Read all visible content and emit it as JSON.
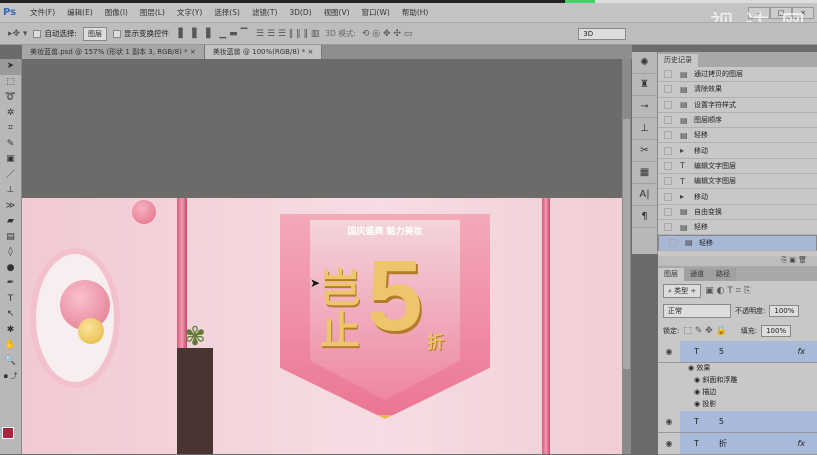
{
  "app": {
    "logo": "Ps",
    "watermark": "视 达 网"
  },
  "menu": [
    "文件(F)",
    "编辑(E)",
    "图像(I)",
    "图层(L)",
    "文字(Y)",
    "选择(S)",
    "滤镜(T)",
    "3D(D)",
    "视图(V)",
    "窗口(W)",
    "帮助(H)"
  ],
  "options": {
    "auto_select": "自动选择:",
    "auto_select_value": "图层",
    "show_transform": "显示变换控件",
    "mode_3d": "3D 模式:",
    "workspace": "3D"
  },
  "tabs": [
    {
      "label": "美妆蓝兽.psd @ 157% (形状 1 副本 3, RGB/8) *",
      "close": "×"
    },
    {
      "label": "美妆蓝兽 @ 100%(RGB/8) *",
      "close": "×"
    }
  ],
  "history": {
    "title": "历史记录",
    "items": [
      {
        "icon": "doc",
        "label": "通过拷贝的图层"
      },
      {
        "icon": "doc",
        "label": "清除效果"
      },
      {
        "icon": "doc",
        "label": "设置字符样式"
      },
      {
        "icon": "doc",
        "label": "图层顺序"
      },
      {
        "icon": "doc",
        "label": "轻移"
      },
      {
        "icon": "move",
        "label": "移动"
      },
      {
        "icon": "type",
        "label": "编辑文字图层"
      },
      {
        "icon": "type",
        "label": "编辑文字图层"
      },
      {
        "icon": "move",
        "label": "移动"
      },
      {
        "icon": "doc",
        "label": "自由变换"
      },
      {
        "icon": "doc",
        "label": "轻移"
      },
      {
        "icon": "doc",
        "label": "轻移",
        "selected": true
      }
    ]
  },
  "layers": {
    "tabs": [
      "图层",
      "通道",
      "路径"
    ],
    "filter": "类型",
    "blend": "正常",
    "opacity_label": "不透明度:",
    "opacity": "100%",
    "lock_label": "锁定:",
    "fill_label": "填充:",
    "fill": "100%",
    "items": [
      {
        "name": "5",
        "fx": "fx",
        "effects_label": "效果",
        "effects": [
          "斜面和浮雕",
          "描边",
          "投影"
        ]
      },
      {
        "name": "5"
      },
      {
        "name": "折",
        "fx": "fx"
      }
    ]
  },
  "banner": {
    "subtitle": "国庆盛典 魅力美妆",
    "main1": "岂",
    "main2": "止",
    "number": "5",
    "suffix": "折"
  }
}
